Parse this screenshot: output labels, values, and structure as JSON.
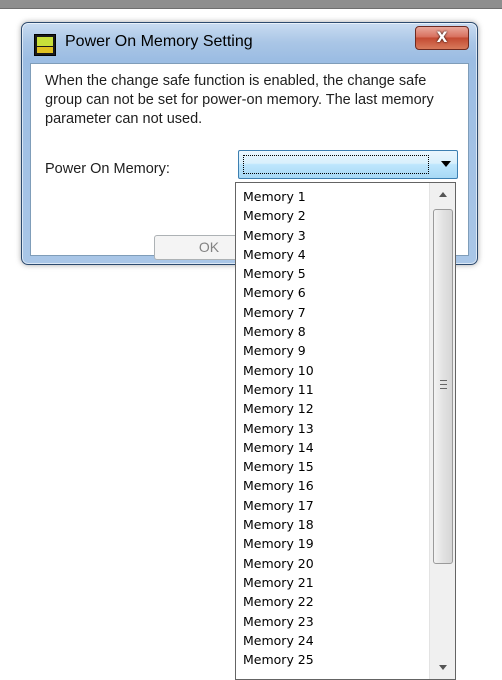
{
  "window": {
    "title": "Power On Memory Setting",
    "close_glyph": "X",
    "icon": "app-icon"
  },
  "dialog": {
    "message": "When the change safe function is enabled, the change safe group can not be set for power-on memory.   The last memory parameter can not used.",
    "power_on_memory_label": "Power On Memory:",
    "combo_value": "",
    "ok_label": "OK"
  },
  "dropdown": {
    "items": [
      "Memory 1",
      "Memory 2",
      "Memory 3",
      "Memory 4",
      "Memory 5",
      "Memory 6",
      "Memory 7",
      "Memory 8",
      "Memory 9",
      "Memory 10",
      "Memory 11",
      "Memory 12",
      "Memory 13",
      "Memory 14",
      "Memory 15",
      "Memory 16",
      "Memory 17",
      "Memory 18",
      "Memory 19",
      "Memory 20",
      "Memory 21",
      "Memory 22",
      "Memory 23",
      "Memory 24",
      "Memory 25"
    ]
  }
}
